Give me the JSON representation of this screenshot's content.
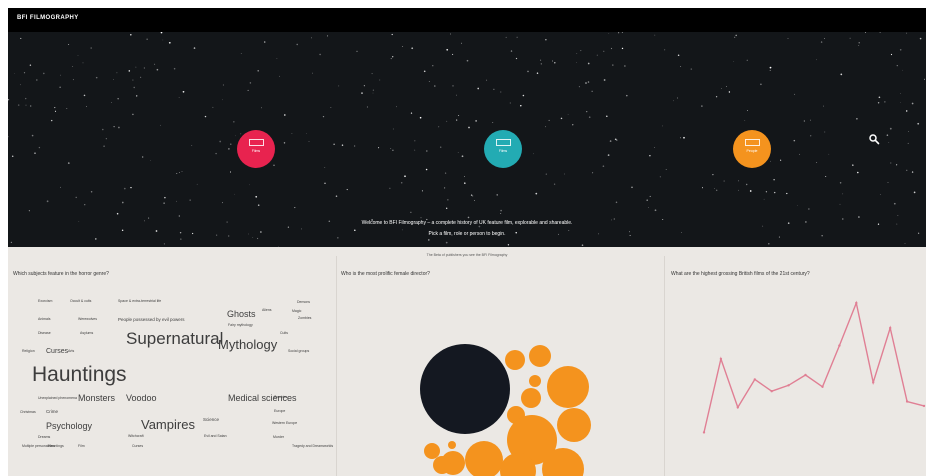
{
  "header": {
    "brand": "BFI FILMOGRAPHY"
  },
  "hero": {
    "planets": [
      {
        "label": "Films",
        "color": "#e8234f"
      },
      {
        "label": "Films",
        "color": "#23abb3"
      },
      {
        "label": "People",
        "color": "#f4931e"
      }
    ],
    "welcome_line1": "Welcome to BFI Filmography – a complete history of UK feature film, explorable and shareable.",
    "welcome_line2": "Pick a film, role or person to begin.",
    "note": "The Beta of publishers you see the BFI Filmography"
  },
  "panels": {
    "horror": {
      "question": "Which subjects feature in the horror genre?",
      "words": [
        "Exorcism",
        "Occult & cults",
        "Space & extra-terrestrial life",
        "Ghosts",
        "Aliens",
        "Demons",
        "Zombies",
        "Animals",
        "Werewolves",
        "People possessed by evil powers",
        "Fairy mythology",
        "Cults",
        "Disease",
        "Asylums",
        "Supernatural",
        "Mythology",
        "Religion",
        "Curses",
        "Arts",
        "Social groups",
        "Hauntings",
        "Unexplained phenomena",
        "Monsters",
        "Voodoo",
        "Medical sciences",
        "Zombies",
        "Christmas",
        "Crime",
        "Europe",
        "Psychology",
        "Vampires",
        "Science",
        "Western Europe",
        "Dreams",
        "Witchcraft",
        "Murder",
        "Multiple personalities",
        "Hauntings",
        "Film",
        "Curses",
        "Evil and Satan",
        "Tragedy and Dreamworlds",
        "Magic"
      ]
    },
    "director": {
      "question": "Who is the most prolific female director?"
    },
    "grossing": {
      "question": "What are the highest grossing British films of the 21st century?",
      "values": [
        12,
        62,
        29,
        48,
        40,
        44,
        51,
        43,
        71,
        100,
        46,
        83,
        33,
        30
      ]
    }
  },
  "colors": {
    "black": "#000000",
    "hero_bg": "#131619",
    "panel_bg": "#ebe8e4",
    "pink": "#e8234f",
    "teal": "#23abb3",
    "orange": "#f4931e",
    "navy": "#141821",
    "line": "#e07f94"
  },
  "icons": {
    "search": "search-icon"
  }
}
